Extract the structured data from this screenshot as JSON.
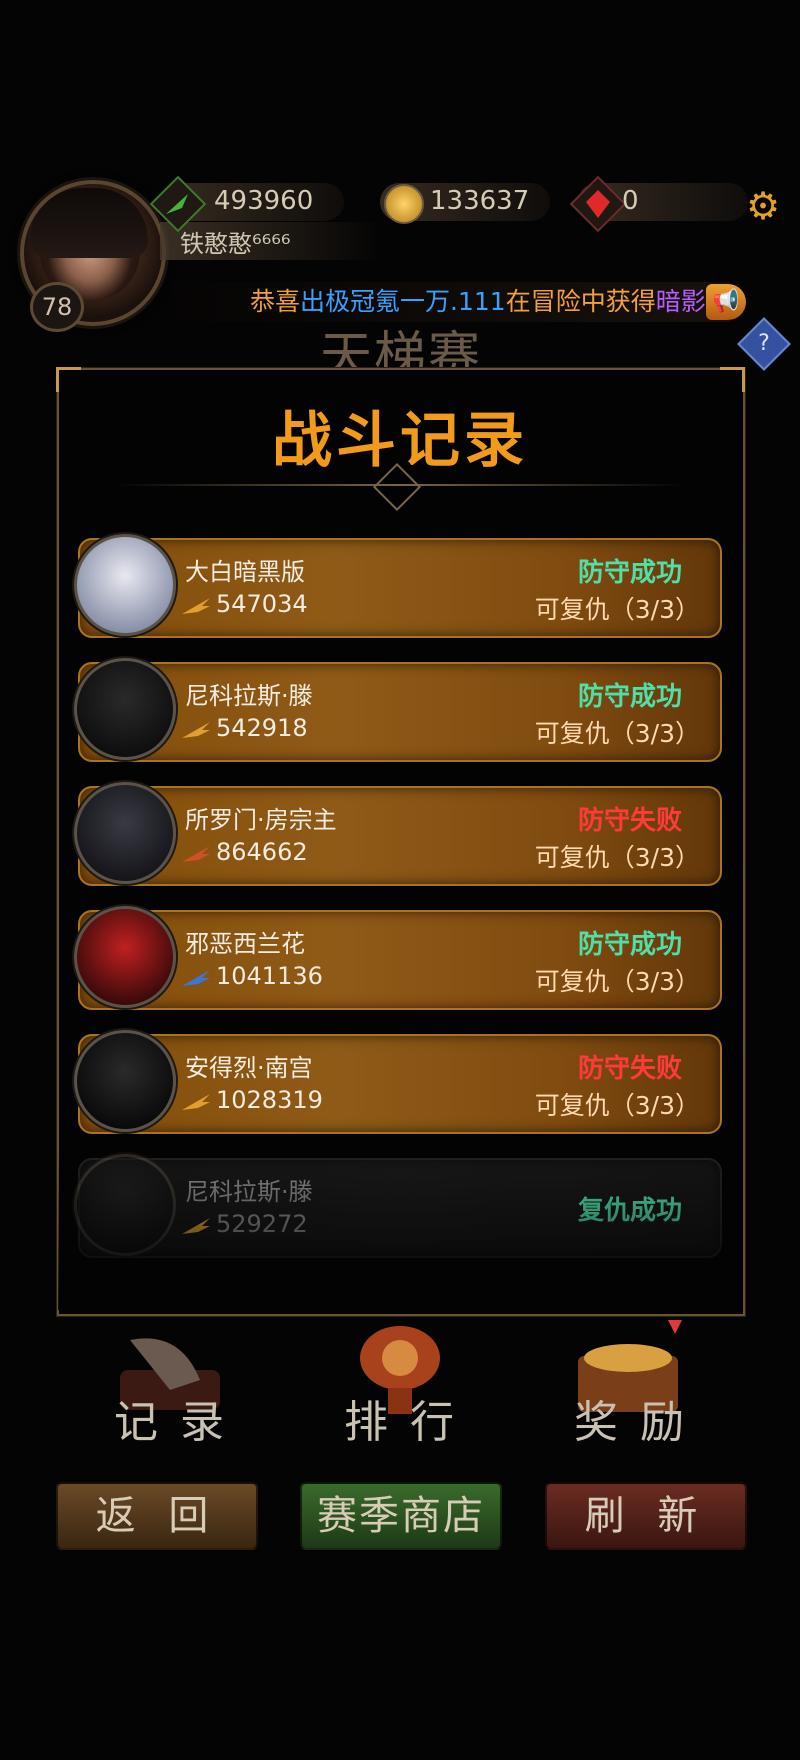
{
  "hud": {
    "level": "78",
    "player_name": "铁憨憨⁶⁶⁶⁶",
    "resources": [
      {
        "icon": "green-feather-icon",
        "value": "493960"
      },
      {
        "icon": "gold-coin-icon",
        "value": "133637"
      },
      {
        "icon": "red-gem-icon",
        "value": "0"
      }
    ],
    "ticker": [
      {
        "text": "恭喜",
        "color": "#f0a040"
      },
      {
        "text": "出极冠氪一万.111",
        "color": "#39a0ff"
      },
      {
        "text": "在冒险中获得",
        "color": "#f0a040"
      },
      {
        "text": "暗影",
        "color": "#b95cff"
      }
    ],
    "background_title": "天梯赛",
    "help": "?"
  },
  "dialog": {
    "title": "战斗记录",
    "records": [
      {
        "name": "大白暗黑版",
        "score": "547034",
        "icon": "golden-wings-icon",
        "status": "防守成功",
        "status_color": "#4fe0a8",
        "revenge": "可复仇（3/3）"
      },
      {
        "name": "尼科拉斯·滕",
        "score": "542918",
        "icon": "golden-wings-icon",
        "status": "防守成功",
        "status_color": "#4fe0a8",
        "revenge": "可复仇（3/3）"
      },
      {
        "name": "所罗门·房宗主",
        "score": "864662",
        "icon": "red-feather-icon",
        "status": "防守失败",
        "status_color": "#ff3a3a",
        "revenge": "可复仇（3/3）"
      },
      {
        "name": "邪恶西兰花",
        "score": "1041136",
        "icon": "blue-feather-icon",
        "status": "防守成功",
        "status_color": "#4fe0a8",
        "revenge": "可复仇（3/3）"
      },
      {
        "name": "安得烈·南宫",
        "score": "1028319",
        "icon": "golden-wings-icon",
        "status": "防守失败",
        "status_color": "#ff3a3a",
        "revenge": "可复仇（3/3）"
      },
      {
        "name": "尼科拉斯·滕",
        "score": "529272",
        "icon": "golden-wings-icon",
        "status": "复仇成功",
        "status_color": "#4fe0a8",
        "revenge": ""
      }
    ]
  },
  "nav": [
    {
      "label": "记录",
      "icon": "quill-book-icon"
    },
    {
      "label": "排行",
      "icon": "trophy-icon"
    },
    {
      "label": "奖励",
      "icon": "treasure-chest-icon"
    }
  ],
  "buttons": {
    "back": "返 回",
    "shop": "赛季商店",
    "refresh": "刷 新"
  }
}
